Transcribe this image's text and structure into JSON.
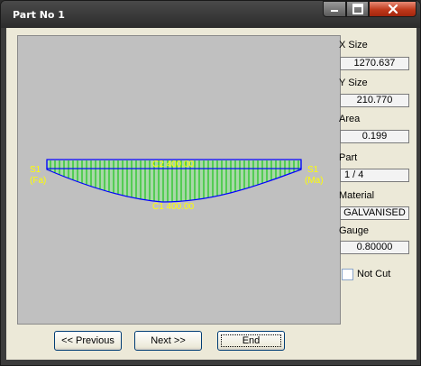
{
  "window": {
    "title": "Part No 1"
  },
  "caption_buttons": {
    "minimize": "minimize-icon",
    "maximize": "maximize-icon",
    "close": "close-icon"
  },
  "drawing": {
    "top_edge_label": "C2 400.00",
    "bottom_edge_label": "C1 400.00",
    "left_side_label": "S1",
    "left_side_code": "(Fa)",
    "right_side_label": "S1",
    "right_side_code": "(Ma)",
    "colors": {
      "background": "#c0c0c0",
      "outline": "#0000ff",
      "hatch": "#00c000",
      "labels": "#ffff00"
    }
  },
  "properties": {
    "x_size_label": "X Size",
    "x_size": "1270.637",
    "y_size_label": "Y Size",
    "y_size": "210.770",
    "area_label": "Area",
    "area": "0.199",
    "part_label": "Part",
    "part": "1 / 4",
    "material_label": "Material",
    "material": "GALVANISED",
    "gauge_label": "Gauge",
    "gauge": "0.80000",
    "not_cut_label": "Not Cut",
    "not_cut_checked": false
  },
  "buttons": {
    "previous": "<< Previous",
    "next": "Next >>",
    "end": "End"
  }
}
